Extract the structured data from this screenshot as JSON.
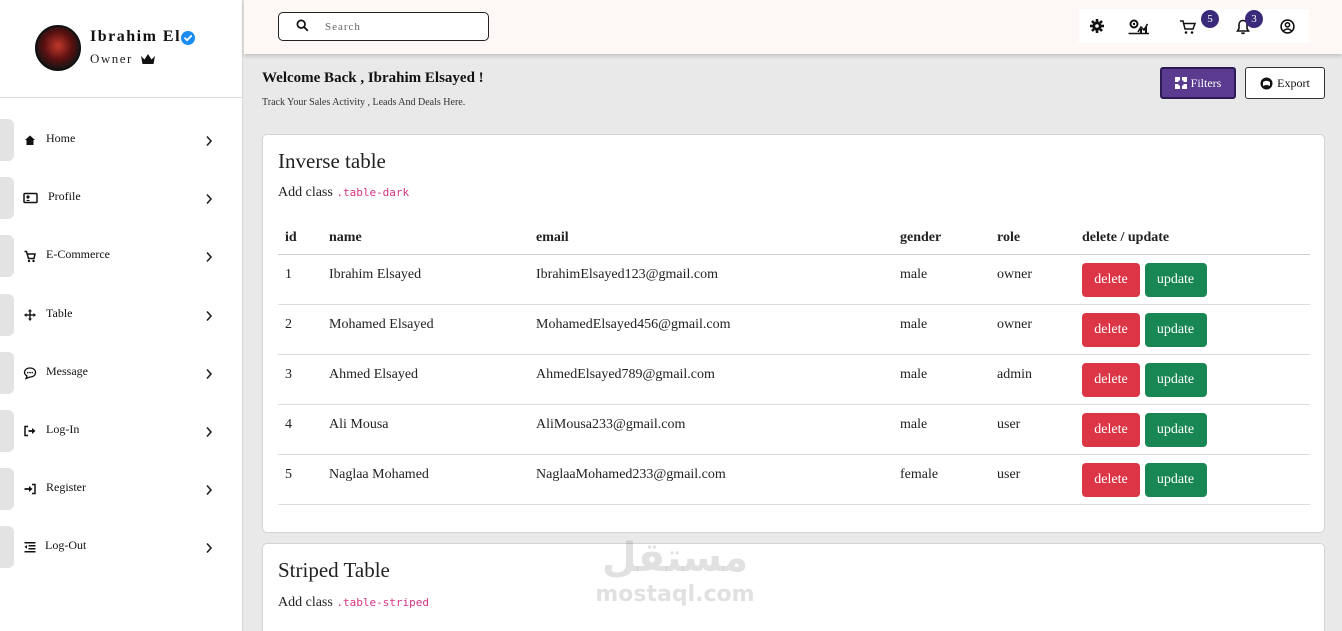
{
  "sidebar": {
    "user_name": "Ibrahim El",
    "user_role": "Owner",
    "items": [
      {
        "label": "Home",
        "icon": "home-icon"
      },
      {
        "label": "Profile",
        "icon": "profile-card-icon"
      },
      {
        "label": "E-Commerce",
        "icon": "cart-icon"
      },
      {
        "label": "Table",
        "icon": "arrows-icon"
      },
      {
        "label": "Message",
        "icon": "message-icon"
      },
      {
        "label": "Log-In",
        "icon": "login-icon"
      },
      {
        "label": "Register",
        "icon": "register-icon"
      },
      {
        "label": "Log-Out",
        "icon": "logout-icon"
      }
    ]
  },
  "topbar": {
    "search_placeholder": "Search",
    "cart_count": "5",
    "notification_count": "3"
  },
  "header": {
    "welcome": "Welcome Back , Ibrahim Elsayed !",
    "subtitle": "Track Your Sales Activity , Leads And Deals Here.",
    "filters_label": "Filters",
    "export_label": "Export"
  },
  "inverse_card": {
    "title": "Inverse table",
    "sub_prefix": "Add class",
    "sub_code": ".table-dark",
    "columns": [
      "id",
      "name",
      "email",
      "gender",
      "role",
      "delete / update"
    ],
    "rows": [
      {
        "id": "1",
        "name": "Ibrahim Elsayed",
        "email": "IbrahimElsayed123@gmail.com",
        "gender": "male",
        "role": "owner"
      },
      {
        "id": "2",
        "name": "Mohamed Elsayed",
        "email": "MohamedElsayed456@gmail.com",
        "gender": "male",
        "role": "owner"
      },
      {
        "id": "3",
        "name": "Ahmed Elsayed",
        "email": "AhmedElsayed789@gmail.com",
        "gender": "male",
        "role": "admin"
      },
      {
        "id": "4",
        "name": "Ali Mousa",
        "email": "AliMousa233@gmail.com",
        "gender": "male",
        "role": "user"
      },
      {
        "id": "5",
        "name": "Naglaa Mohamed",
        "email": "NaglaaMohamed233@gmail.com",
        "gender": "female",
        "role": "user"
      }
    ],
    "delete_label": "delete",
    "update_label": "update"
  },
  "striped_card": {
    "title": "Striped Table",
    "sub_prefix": "Add class",
    "sub_code": ".table-striped"
  },
  "watermark": {
    "arabic": "مستقل",
    "latin": "mostaql.com"
  },
  "colors": {
    "accent": "#5b3b8f",
    "badge": "#3b2a7a",
    "danger": "#dc3545",
    "success": "#198754",
    "verified": "#1d8cf0",
    "code": "#d63384"
  }
}
